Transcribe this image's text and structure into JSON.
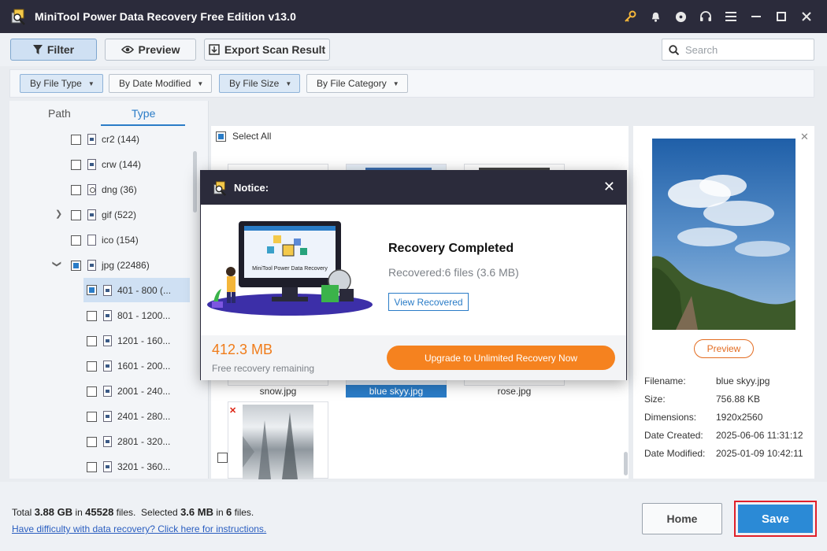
{
  "window": {
    "title": "MiniTool Power Data Recovery Free Edition v13.0",
    "icons": [
      "key-icon",
      "bell-icon",
      "disc-icon",
      "headset-icon",
      "menu-icon",
      "minimize-icon",
      "maximize-icon",
      "close-icon"
    ],
    "key_color": "#f4b63a"
  },
  "toolbar": {
    "filter_label": "Filter",
    "preview_label": "Preview",
    "export_label": "Export Scan Result",
    "search_placeholder": "Search"
  },
  "filters": [
    {
      "label": "By File Type",
      "active": true
    },
    {
      "label": "By Date Modified",
      "active": false
    },
    {
      "label": "By File Size",
      "active": true
    },
    {
      "label": "By File Category",
      "active": false
    }
  ],
  "left": {
    "tabs": [
      {
        "label": "Path"
      },
      {
        "label": "Type",
        "selected": true
      }
    ],
    "tree": [
      {
        "label": "cr2 (144)"
      },
      {
        "label": "crw (144)"
      },
      {
        "label": "dng (36)"
      },
      {
        "label": "gif (522)"
      },
      {
        "label": "ico (154)"
      },
      {
        "label": "jpg (22486)"
      },
      {
        "label": "401 - 800 (..."
      },
      {
        "label": "801 - 1200..."
      },
      {
        "label": "1201 - 160..."
      },
      {
        "label": "1601 - 200..."
      },
      {
        "label": "2001 - 240..."
      },
      {
        "label": "2401 - 280..."
      },
      {
        "label": "2801 - 320..."
      },
      {
        "label": "3201 - 360..."
      }
    ]
  },
  "center": {
    "select_all_label": "Select All",
    "files": [
      {
        "name": "snow.jpg"
      },
      {
        "name": "blue skyy.jpg",
        "selected": true
      },
      {
        "name": "rose.jpg"
      }
    ]
  },
  "right": {
    "preview_button": "Preview",
    "details": [
      {
        "key": "Filename:",
        "value": "blue skyy.jpg"
      },
      {
        "key": "Size:",
        "value": "756.88 KB"
      },
      {
        "key": "Dimensions:",
        "value": "1920x2560"
      },
      {
        "key": "Date Created:",
        "value": "2025-06-06 11:31:12"
      },
      {
        "key": "Date Modified:",
        "value": "2025-01-09 10:42:11"
      }
    ]
  },
  "bottom": {
    "total_prefix": "Total",
    "total_size": "3.88 GB",
    "in_word": "in",
    "total_files": "45528",
    "files_word": "files.",
    "selected_prefix": "Selected",
    "selected_size": "3.6 MB",
    "selected_files": "6",
    "help_link": "Have difficulty with data recovery? Click here for instructions.",
    "home_label": "Home",
    "save_label": "Save"
  },
  "notice": {
    "title": "Notice:",
    "illustration_text": "MiniTool Power Data Recovery",
    "heading": "Recovery Completed",
    "subtitle": "Recovered:6 files (3.6 MB)",
    "view_recovered": "View Recovered",
    "remaining_size": "412.3 MB",
    "remaining_label": "Free recovery remaining",
    "upgrade_label": "Upgrade to Unlimited Recovery Now",
    "accent_color": "#f5821f"
  }
}
